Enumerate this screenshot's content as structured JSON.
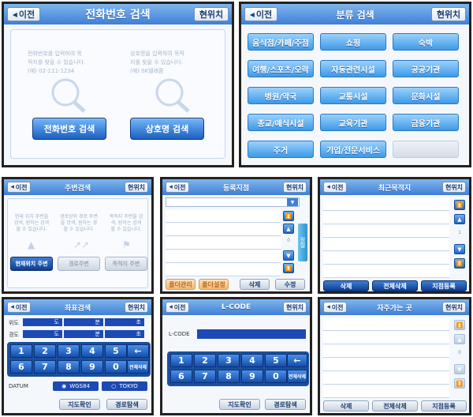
{
  "common": {
    "back": "이전",
    "current": "현위치"
  },
  "phone_search": {
    "title": "전화번호 검색",
    "hint_left": [
      "전화번호를 입력하여 목",
      "적지를 찾을 수 있습니다.",
      "(예) 02-111-1234"
    ],
    "hint_right": [
      "상호명을 입력하여 목적",
      "지를 찾을 수 있습니다.",
      "(예) SK텔레콤"
    ],
    "btn_phone": "전화번호 검색",
    "btn_name": "상호명 검색"
  },
  "category_search": {
    "title": "분류 검색",
    "categories": [
      "음식점/카페/주점",
      "쇼핑",
      "숙박",
      "여행/스포츠/오락",
      "자동관련시설",
      "공공기관",
      "병원/약국",
      "교통시설",
      "문화시설",
      "종교/예식시설",
      "교육기관",
      "금융기관",
      "주거",
      "기업/전문서비스",
      ""
    ]
  },
  "nearby_search": {
    "title": "주변검색",
    "hints": [
      [
        "현재 위치 주변을",
        "검색, 원하는 검색",
        "할 수 있습니다."
      ],
      [
        "경로상의 경로 주변",
        "을 검색, 원하는 경",
        "할 수 있습니다."
      ],
      [
        "목적지 주변을 검",
        "색, 원하는 검색",
        "할 수 있습니다."
      ]
    ],
    "btn_current": "현재위치 주변",
    "btn_route": "경로주변",
    "btn_dest": "목적지 주변"
  },
  "registered": {
    "title": "등록지점",
    "side_tab": "정렬",
    "page_num": "0",
    "btn_a": "폴더관리",
    "btn_b": "폴더설정",
    "btn_delete": "삭제",
    "btn_edit": "수정"
  },
  "recent": {
    "title": "최근목적지",
    "page_num": "1",
    "btn_delete": "삭제",
    "btn_delete_all": "전체삭제",
    "btn_register": "지점등록"
  },
  "coord_search": {
    "title": "좌표검색",
    "lat_label": "위도",
    "lon_label": "경도",
    "units": [
      "도",
      "분",
      "초"
    ],
    "keys_row1": [
      "1",
      "2",
      "3",
      "4",
      "5"
    ],
    "keys_row2": [
      "6",
      "7",
      "8",
      "9",
      "0"
    ],
    "backspace": "←",
    "clear_all": "전체삭제",
    "datum_label": "DATUM",
    "datum_opt1": "WGS84",
    "datum_opt2": "TOKYO",
    "btn_map": "지도확인",
    "btn_route": "경로탐색"
  },
  "lcode": {
    "title": "L-CODE",
    "field_label": "L-CODE",
    "keys_row1": [
      "1",
      "2",
      "3",
      "4",
      "5"
    ],
    "keys_row2": [
      "6",
      "7",
      "8",
      "9",
      "0"
    ],
    "backspace": "←",
    "clear_all": "전체삭제",
    "btn_map": "지도확인",
    "btn_route": "경로탐색"
  },
  "frequent": {
    "title": "자주가는 곳",
    "page_num": "0",
    "btn_delete": "삭제",
    "btn_delete_all": "전체삭제",
    "btn_register": "지점등록"
  },
  "colors": {
    "header": "#3f7fd6",
    "panel_bg": "#eef3fb",
    "key": "#144fae",
    "field": "#1c49b4"
  }
}
